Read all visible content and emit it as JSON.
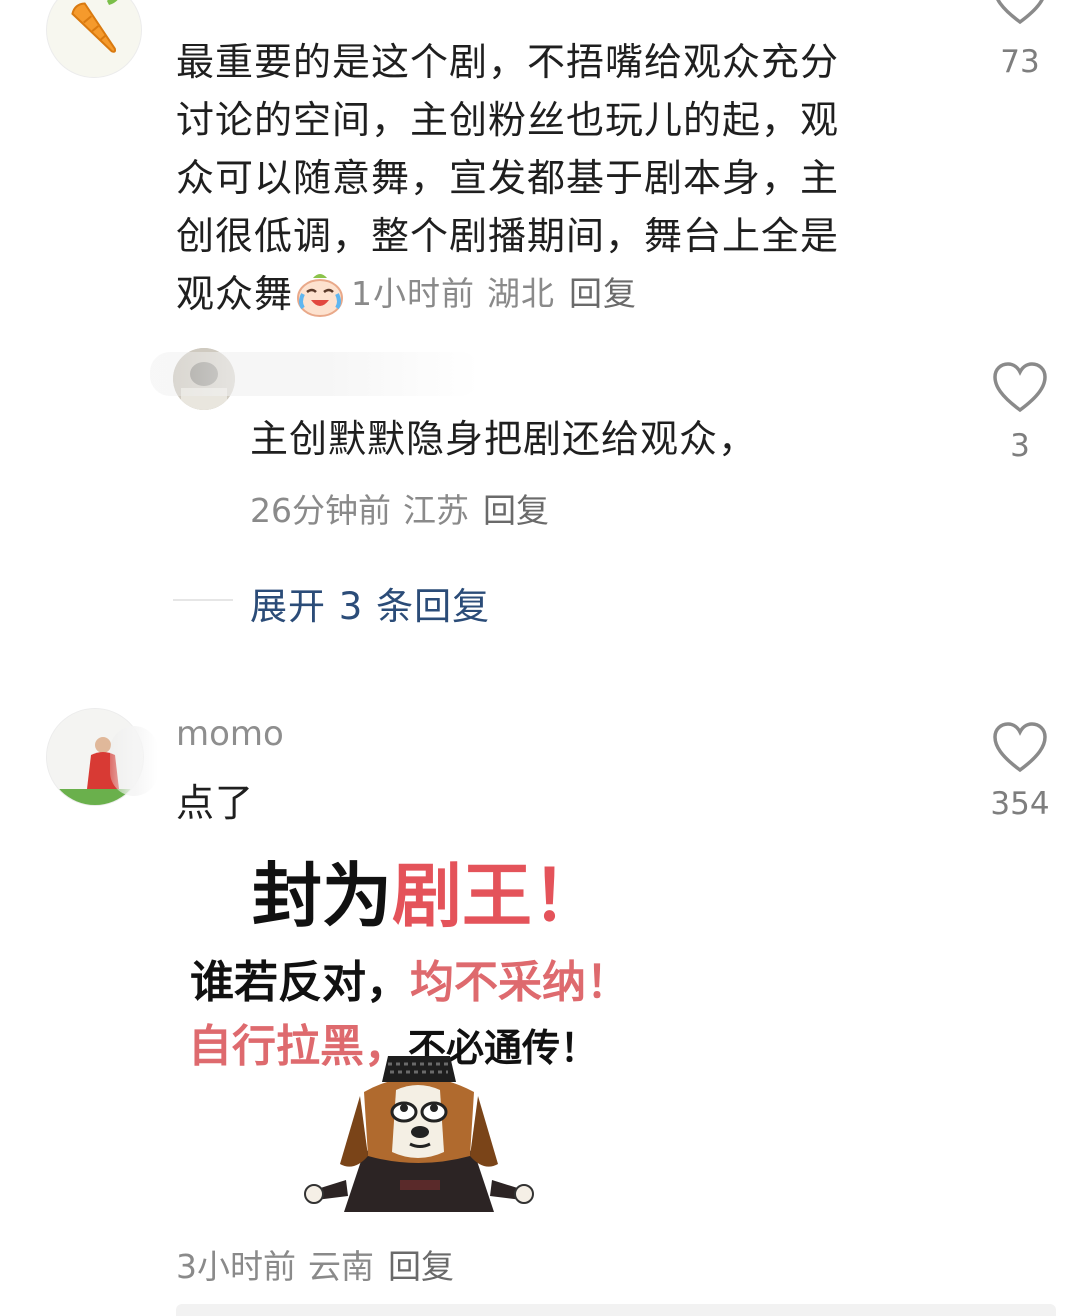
{
  "comments": [
    {
      "text_lines": [
        "最重要的是这个剧，不捂嘴给观众充分",
        "讨论的空间，主创粉丝也玩儿的起，观",
        "众可以随意舞，宣发都基于剧本身，主",
        "创很低调，整个剧播期间，舞台上全是",
        "观众舞"
      ],
      "time": "1小时前",
      "location": "湖北",
      "reply_label": "回复",
      "like_count": "73"
    }
  ],
  "reply": {
    "text": "主创默默隐身把剧还给观众，",
    "time": "26分钟前",
    "location": "江苏",
    "reply_label": "回复",
    "like_count": "3"
  },
  "expand": {
    "label": "展开 3 条回复"
  },
  "comment2": {
    "username": "momo",
    "text": "点了",
    "time": "3小时前",
    "location": "云南",
    "reply_label": "回复",
    "like_count": "354",
    "meme": {
      "line1_black": "封为",
      "line1_red": "剧王！",
      "line2_black": "谁若反对，",
      "line2_red": "均不采纳！",
      "line3_red": "自行拉黑，",
      "line3_black": "不必通传！"
    }
  },
  "colors": {
    "link_blue": "#2b4c78",
    "meta_gray": "#8a8a8a",
    "meme_red": "#e4535a"
  },
  "icons": [
    "carrot-avatar-icon",
    "laugh-cry-emoji-icon",
    "heart-icon"
  ]
}
